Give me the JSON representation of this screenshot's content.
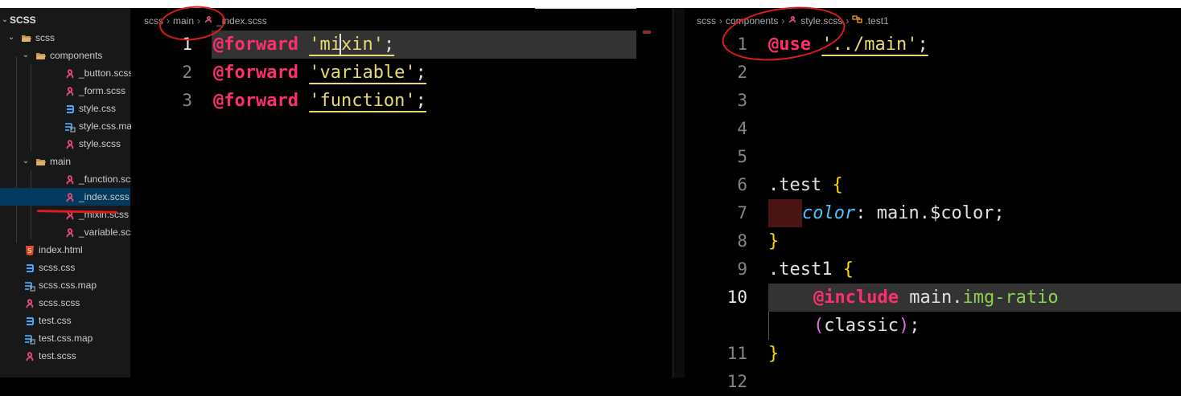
{
  "explorer": {
    "root_label": "SCSS",
    "items": [
      {
        "label": "scss",
        "kind": "folder-open",
        "depth": 0
      },
      {
        "label": "components",
        "kind": "folder-open",
        "depth": 1
      },
      {
        "label": "_button.scss",
        "kind": "scss",
        "depth": 2
      },
      {
        "label": "_form.scss",
        "kind": "scss",
        "depth": 2
      },
      {
        "label": "style.css",
        "kind": "css",
        "depth": 2
      },
      {
        "label": "style.css.map",
        "kind": "map",
        "depth": 2
      },
      {
        "label": "style.scss",
        "kind": "scss",
        "depth": 2
      },
      {
        "label": "main",
        "kind": "folder-open",
        "depth": 1
      },
      {
        "label": "_function.scss",
        "kind": "scss",
        "depth": 2
      },
      {
        "label": "_index.scss",
        "kind": "scss",
        "depth": 2,
        "selected": true
      },
      {
        "label": "_mixin.scss",
        "kind": "scss",
        "depth": 2
      },
      {
        "label": "_variable.scss",
        "kind": "scss",
        "depth": 2
      },
      {
        "label": "index.html",
        "kind": "html",
        "depth": 0
      },
      {
        "label": "scss.css",
        "kind": "css",
        "depth": 0
      },
      {
        "label": "scss.css.map",
        "kind": "map",
        "depth": 0
      },
      {
        "label": "scss.scss",
        "kind": "scss",
        "depth": 0
      },
      {
        "label": "test.css",
        "kind": "css",
        "depth": 0
      },
      {
        "label": "test.css.map",
        "kind": "map",
        "depth": 0
      },
      {
        "label": "test.scss",
        "kind": "scss",
        "depth": 0
      }
    ]
  },
  "left_editor": {
    "breadcrumb": [
      "scss",
      "main",
      "_index.scss"
    ],
    "lines": [
      {
        "num": "1",
        "keyword": "@forward",
        "module": "'mixin'",
        "end": ";"
      },
      {
        "num": "2",
        "keyword": "@forward",
        "module": "'variable'",
        "end": ";"
      },
      {
        "num": "3",
        "keyword": "@forward",
        "module": "'function'",
        "end": ";"
      }
    ]
  },
  "right_editor": {
    "breadcrumb": [
      "scss",
      "components",
      "style.scss",
      ".test1"
    ],
    "line_numbers": [
      "1",
      "2",
      "3",
      "4",
      "5",
      "6",
      "7",
      "8",
      "9",
      "10",
      "",
      "11",
      "12"
    ],
    "code": {
      "use_kw": "@use",
      "use_path": "'../main'",
      "use_end": ";",
      "test_selector": ".test",
      "open_brace": "{",
      "close_brace": "}",
      "color_prop": "color",
      "color_colon": ":",
      "color_value": "main.$color;",
      "test1_selector": ".test1",
      "include_kw": "@include",
      "include_ns": "main.",
      "include_fn": "img-ratio",
      "paren_open": "(",
      "arg": "classic",
      "paren_close": ")",
      "include_end": ";"
    }
  },
  "colors": {
    "scss_icon": "#e44c7a",
    "css_icon": "#42a5f5",
    "html_icon": "#e44d26",
    "folder_icon": "#c09553",
    "annotation": "#e01b1b"
  }
}
